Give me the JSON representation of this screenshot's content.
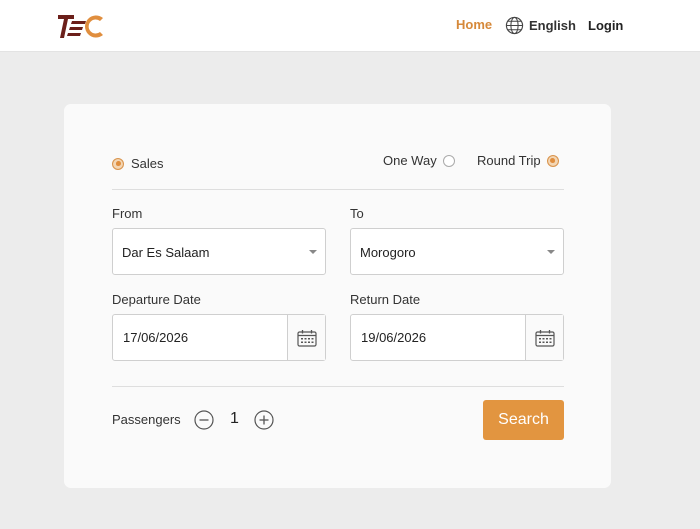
{
  "header": {
    "logo_text": "TEC",
    "nav": {
      "home": "Home",
      "language": "English",
      "login": "Login"
    },
    "accent_color": "#d6893a"
  },
  "form": {
    "mode": {
      "label": "Sales",
      "selected": true
    },
    "trip_types": [
      {
        "label": "One Way",
        "selected": false
      },
      {
        "label": "Round Trip",
        "selected": true
      }
    ],
    "from": {
      "label": "From",
      "value": "Dar Es Salaam"
    },
    "to": {
      "label": "To",
      "value": "Morogoro"
    },
    "departure": {
      "label": "Departure Date",
      "value": "17/06/2026"
    },
    "return": {
      "label": "Return Date",
      "value": "19/06/2026"
    },
    "passengers": {
      "label": "Passengers",
      "count": "1"
    },
    "search_label": "Search"
  },
  "icons": {
    "language": "globe-icon",
    "calendar": "calendar-icon",
    "decrement": "minus-circle-icon",
    "increment": "plus-circle-icon",
    "dropdown": "chevron-down-icon"
  },
  "colors": {
    "button": "#e29540",
    "radio_selected": "#e7a25c"
  }
}
